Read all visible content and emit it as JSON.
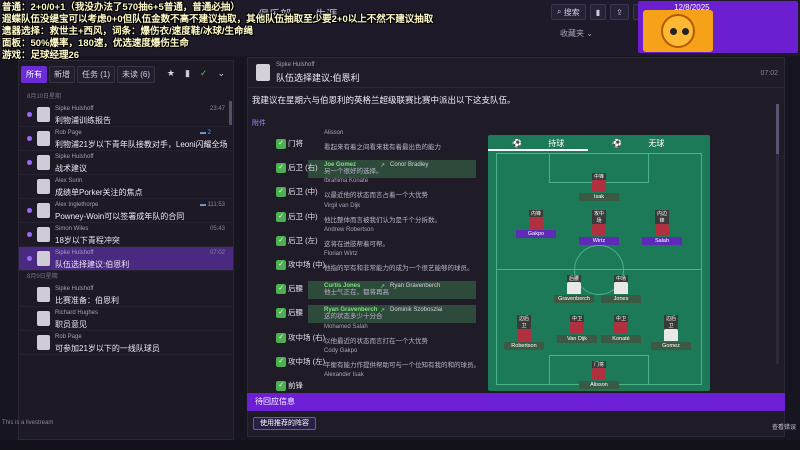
{
  "overlay": {
    "lines": [
      "普通：2+0/0+1（我没办法了570抽6+5普通，普通必抽）",
      "遐蝶队伍没缇宝可以考虑0+0但队伍金数不高不建议抽取，其他队伍抽取至少要2+0以上不然不建议抽取",
      "遗器选择：救世主+西风，词条：爆伤衣/速度鞋/冰球/生命绳",
      "面板：50%爆率，180速，优选速度爆伤生命",
      "游戏：足球经理26"
    ]
  },
  "nav": {
    "tabs": [
      "俱乐部",
      "生涯"
    ]
  },
  "top_tools": {
    "search": "搜索",
    "date": "12/8/2025",
    "favorites": "收藏夹"
  },
  "left": {
    "filters": [
      "所有",
      "新增",
      "任务 (1)",
      "未读 (6)"
    ],
    "groups": [
      {
        "date": "8月10日星期",
        "messages": [
          {
            "from": "Sipke Hulshoff",
            "subject": "利物浦训练报告",
            "time": "23:47",
            "unread": true
          },
          {
            "from": "Rob Page",
            "subject": "利物浦21岁以下青年队接教对手，Leoni闪耀全场",
            "time": "",
            "comments": "2",
            "unread": true
          },
          {
            "from": "Sipke Hulshoff",
            "subject": "战术建议",
            "time": "",
            "unread": true
          },
          {
            "from": "Alex Surin",
            "subject": "成绩单Porker关注的焦点",
            "time": "",
            "unread": false
          },
          {
            "from": "Alex Inglethorpe",
            "subject": "Powney-Woin可以签署成年队的合同",
            "time": "11:53",
            "comments": "1",
            "unread": true
          },
          {
            "from": "Simon Wiles",
            "subject": "18岁以下青程冲突",
            "time": "05:43",
            "unread": true
          },
          {
            "from": "Sipke Hulshoff",
            "subject": "队伍选择建议:伯恩利",
            "time": "07:02",
            "unread": true,
            "selected": true
          }
        ]
      },
      {
        "date": "8月9日星期",
        "messages": [
          {
            "from": "Sipke Hulshoff",
            "subject": "比赛准备：伯恩利",
            "time": "",
            "unread": false
          },
          {
            "from": "Richard Hughes",
            "subject": "职员意见",
            "time": "",
            "unread": false
          },
          {
            "from": "Rob Page",
            "subject": "可参加21岁以下的一线队球员",
            "time": "",
            "unread": false
          }
        ]
      }
    ]
  },
  "email": {
    "from": "Sipke Hulshoff",
    "subject": "队伍选择建议:伯恩利",
    "time": "07:02",
    "body": "我建议在星期六与伯恩利的英格兰超级联赛比赛中派出以下这支队伍。",
    "attachment_label": "附件",
    "lineup": [
      {
        "pos": "门将",
        "name": "Alisson",
        "desc": "看起来有着之间看来我有着最出色的能力",
        "highlight": false
      },
      {
        "pos": "后卫 (右)",
        "name": "Joe Gomez",
        "alt": "Conor Bradley",
        "desc": "另一个很好的选择。",
        "highlight": true
      },
      {
        "pos": "后卫 (中)",
        "name": "Ibrahima Konaté",
        "desc": "以最近他的状态而言占着一个大优势",
        "highlight": false
      },
      {
        "pos": "后卫 (中)",
        "name": "Virgil van Dijk",
        "desc": "他比整体而言被我们认为是千个分拆数。",
        "highlight": false
      },
      {
        "pos": "后卫 (左)",
        "name": "Andrew Robertson",
        "desc": "这将在进肢帮着可帮。",
        "highlight": false
      },
      {
        "pos": "攻中场 (中)",
        "name": "Florian Wirtz",
        "desc": "他指的罕有和非常能力的成为一个很艺能够的球员。",
        "highlight": false
      },
      {
        "pos": "后腰",
        "name": "Curtis Jones",
        "alt": "Ryan Gravenberch",
        "desc": "他士气正在，都将再高",
        "highlight": true
      },
      {
        "pos": "后腰",
        "name": "Ryan Gravenberch",
        "alt": "Dominik Szoboszlai",
        "desc": "这的状态多少十分合",
        "highlight": true
      },
      {
        "pos": "攻中场 (右)",
        "name": "Mohamed Salah",
        "desc": "以他最近的状态而言打在一个大优势",
        "highlight": false
      },
      {
        "pos": "攻中场 (左)",
        "name": "Cody Gakpo",
        "desc": "平衡有能力作提供帮助可与一个位知有我的和的球员。",
        "highlight": false
      },
      {
        "pos": "前锋",
        "name": "Alexander Isak",
        "desc": "",
        "highlight": false
      }
    ],
    "pitch_tabs": [
      "持球",
      "无球"
    ],
    "pitch_players": [
      {
        "name": "Isak",
        "role": "中锋",
        "kit": "red",
        "tag": "grey"
      },
      {
        "name": "Gakpo",
        "role": "内锋",
        "kit": "red",
        "tag": "purple"
      },
      {
        "name": "Wirtz",
        "role": "攻中场",
        "kit": "red",
        "tag": "purple"
      },
      {
        "name": "Salah",
        "role": "内边锋",
        "kit": "red",
        "tag": "purple"
      },
      {
        "name": "Gravenberch",
        "role": "后腰",
        "kit": "white",
        "tag": "grey"
      },
      {
        "name": "Jones",
        "role": "中场",
        "kit": "white",
        "tag": "grey"
      },
      {
        "name": "Robertson",
        "role": "边后卫",
        "kit": "red",
        "tag": "grey"
      },
      {
        "name": "Van Dijk",
        "role": "中卫",
        "kit": "red",
        "tag": "grey"
      },
      {
        "name": "Konaté",
        "role": "中卫",
        "kit": "red",
        "tag": "grey"
      },
      {
        "name": "Gomez",
        "role": "边后卫",
        "kit": "white",
        "tag": "grey"
      },
      {
        "name": "Alisson",
        "role": "门将",
        "kit": "red",
        "tag": "grey"
      }
    ]
  },
  "pending": {
    "label": "待回应信息",
    "button": "使用推荐的阵容"
  },
  "footer": {
    "errors": "查看错误",
    "watermark": "This is a livestream"
  },
  "colors": {
    "accent": "#6c1fd4",
    "pitch": "#1c7a58"
  }
}
